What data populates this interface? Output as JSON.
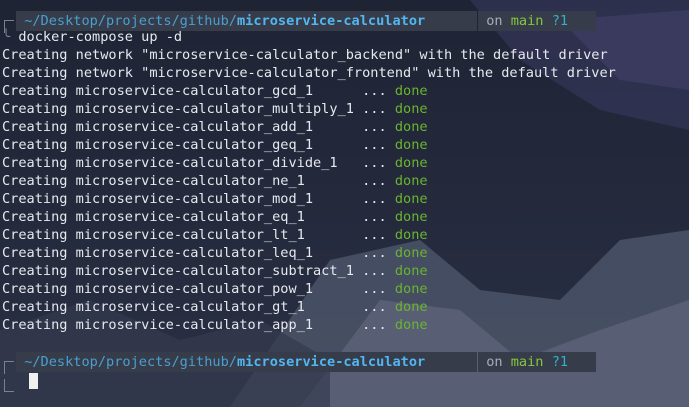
{
  "prompt": {
    "path_prefix": "~/Desktop/projects/github/",
    "path_current": "microservice-calculator",
    "git_on": "on",
    "git_branch": "main",
    "git_status": "?1"
  },
  "command": "docker-compose up -d",
  "network_lines": [
    "Creating network \"microservice-calculator_backend\" with the default driver",
    "Creating network \"microservice-calculator_frontend\" with the default driver"
  ],
  "container_lines": [
    {
      "text": "Creating microservice-calculator_gcd_1      ... ",
      "status": "done"
    },
    {
      "text": "Creating microservice-calculator_multiply_1 ... ",
      "status": "done"
    },
    {
      "text": "Creating microservice-calculator_add_1      ... ",
      "status": "done"
    },
    {
      "text": "Creating microservice-calculator_geq_1      ... ",
      "status": "done"
    },
    {
      "text": "Creating microservice-calculator_divide_1   ... ",
      "status": "done"
    },
    {
      "text": "Creating microservice-calculator_ne_1       ... ",
      "status": "done"
    },
    {
      "text": "Creating microservice-calculator_mod_1      ... ",
      "status": "done"
    },
    {
      "text": "Creating microservice-calculator_eq_1       ... ",
      "status": "done"
    },
    {
      "text": "Creating microservice-calculator_lt_1       ... ",
      "status": "done"
    },
    {
      "text": "Creating microservice-calculator_leq_1      ... ",
      "status": "done"
    },
    {
      "text": "Creating microservice-calculator_subtract_1 ... ",
      "status": "done"
    },
    {
      "text": "Creating microservice-calculator_pow_1      ... ",
      "status": "done"
    },
    {
      "text": "Creating microservice-calculator_gt_1       ... ",
      "status": "done"
    },
    {
      "text": "Creating microservice-calculator_app_1      ... ",
      "status": "done"
    }
  ]
}
